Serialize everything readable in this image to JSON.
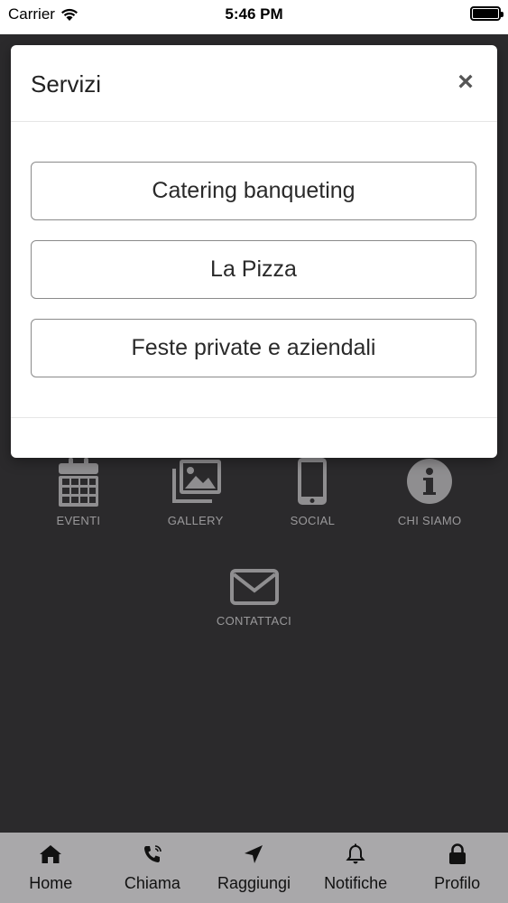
{
  "status_bar": {
    "carrier": "Carrier",
    "time": "5:46 PM"
  },
  "modal": {
    "title": "Servizi",
    "close_symbol": "×",
    "buttons": [
      "Catering banqueting",
      "La Pizza",
      "Feste private e aziendali"
    ]
  },
  "grid": {
    "items": [
      {
        "label": "EVENTI",
        "icon": "calendar-icon"
      },
      {
        "label": "GALLERY",
        "icon": "images-icon"
      },
      {
        "label": "SOCIAL",
        "icon": "mobile-phone-icon"
      },
      {
        "label": "CHI SIAMO",
        "icon": "info-circle-icon"
      },
      {
        "label": "CONTATTACI",
        "icon": "envelope-icon"
      }
    ]
  },
  "tab_bar": {
    "items": [
      {
        "label": "Home",
        "icon": "home-icon"
      },
      {
        "label": "Chiama",
        "icon": "phone-icon"
      },
      {
        "label": "Raggiungi",
        "icon": "location-arrow-icon"
      },
      {
        "label": "Notifiche",
        "icon": "bell-icon"
      },
      {
        "label": "Profilo",
        "icon": "lock-icon"
      }
    ]
  },
  "colors": {
    "background": "#2b2a2c",
    "tab_bar": "#a9a8aa",
    "grid_icon": "#8f8e90",
    "grid_label": "#9a999b"
  }
}
